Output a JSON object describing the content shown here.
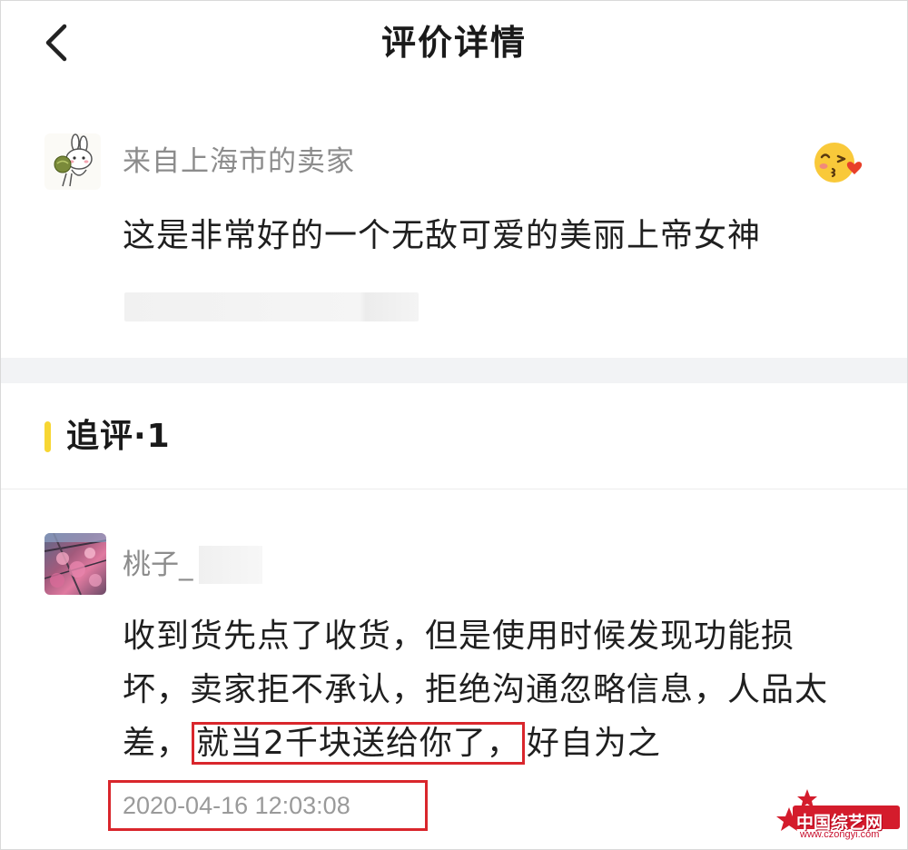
{
  "header": {
    "title": "评价详情"
  },
  "review": {
    "seller_name": "来自上海市的卖家",
    "text": "这是非常好的一个无敌可爱的美丽上帝女神"
  },
  "followup": {
    "title": "追评·1",
    "user_name": "桃子_",
    "comment": {
      "line1": "收到货先点了收货，但是使用时候发现功能损",
      "line2": "坏，卖家拒不承认，拒绝沟通忽略信息，人品太",
      "line3_prefix": "差，",
      "line3_highlight": "就当2千块送给你了，",
      "line3_suffix": "好自为之"
    },
    "timestamp": "2020-04-16 12:03:08"
  },
  "watermark": {
    "title": "中国综艺网",
    "url": "www.czongyi.com"
  },
  "colors": {
    "accent_yellow": "#f7d633",
    "highlight_red": "#d9262c",
    "divider_gray": "#f2f3f5",
    "meta_text": "#8c8c8c"
  },
  "icons": {
    "back": "chevron-left-icon",
    "emoji": "kiss-emoji-icon"
  }
}
